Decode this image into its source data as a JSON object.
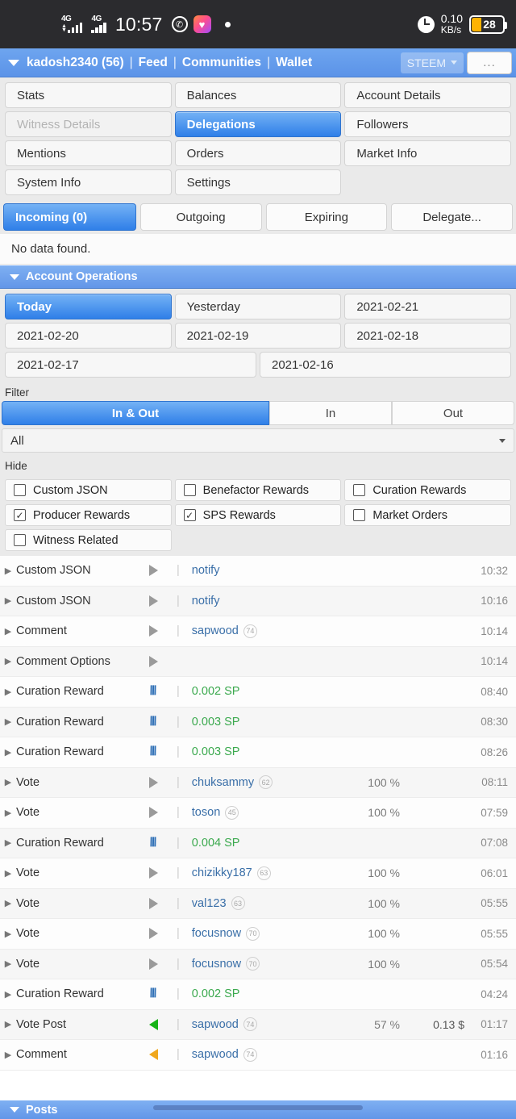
{
  "statusbar": {
    "network1": "4G",
    "network2": "4G",
    "time": "10:57",
    "whatsapp_icon": "whatsapp-icon",
    "gallery_icon": "heart-app-icon",
    "dot_icon": "dot-icon",
    "alarm_icon": "alarm-clock-icon",
    "netspeed_value": "0.10",
    "netspeed_unit": "KB/s",
    "battery_level": "28"
  },
  "appbar": {
    "account": "kadosh2340 (56)",
    "sep": "|",
    "nav": [
      "Feed",
      "Communities",
      "Wallet"
    ],
    "chain_chip": "STEEM",
    "more_label": "..."
  },
  "nav_tiles": [
    {
      "label": "Stats",
      "state": "normal"
    },
    {
      "label": "Balances",
      "state": "normal"
    },
    {
      "label": "Account Details",
      "state": "normal"
    },
    {
      "label": "Witness Details",
      "state": "disabled"
    },
    {
      "label": "Delegations",
      "state": "active"
    },
    {
      "label": "Followers",
      "state": "normal"
    },
    {
      "label": "Mentions",
      "state": "normal"
    },
    {
      "label": "Orders",
      "state": "normal"
    },
    {
      "label": "Market Info",
      "state": "normal"
    },
    {
      "label": "System Info",
      "state": "normal"
    },
    {
      "label": "Settings",
      "state": "normal"
    },
    {
      "label": "",
      "state": "blank"
    }
  ],
  "delegation_tabs": [
    {
      "label": "Incoming (0)",
      "active": true
    },
    {
      "label": "Outgoing",
      "active": false
    },
    {
      "label": "Expiring",
      "active": false
    },
    {
      "label": "Delegate...",
      "active": false
    }
  ],
  "delegation_empty": "No data found.",
  "account_operations": {
    "section_title": "Account Operations",
    "date_tiles": [
      {
        "label": "Today",
        "active": true,
        "width": "w3"
      },
      {
        "label": "Yesterday",
        "active": false,
        "width": "w3"
      },
      {
        "label": "2021-02-21",
        "active": false,
        "width": "w3"
      },
      {
        "label": "2021-02-20",
        "active": false,
        "width": "w3"
      },
      {
        "label": "2021-02-19",
        "active": false,
        "width": "w3"
      },
      {
        "label": "2021-02-18",
        "active": false,
        "width": "w3"
      },
      {
        "label": "2021-02-17",
        "active": false,
        "width": "w2"
      },
      {
        "label": "2021-02-16",
        "active": false,
        "width": "w2"
      }
    ],
    "filter_label": "Filter",
    "direction_buttons": [
      {
        "label": "In & Out",
        "active": true
      },
      {
        "label": "In",
        "active": false
      },
      {
        "label": "Out",
        "active": false
      }
    ],
    "type_select_value": "All",
    "hide_label": "Hide",
    "hide_checkboxes": [
      {
        "label": "Custom JSON",
        "checked": false
      },
      {
        "label": "Benefactor Rewards",
        "checked": false
      },
      {
        "label": "Curation Rewards",
        "checked": false
      },
      {
        "label": "Producer Rewards",
        "checked": true
      },
      {
        "label": "SPS Rewards",
        "checked": true
      },
      {
        "label": "Market Orders",
        "checked": false
      },
      {
        "label": "Witness Related",
        "checked": false
      }
    ]
  },
  "operations": [
    {
      "type": "Custom JSON",
      "icon": "arrow-right-gray",
      "user": "notify",
      "rep": "",
      "amount": "",
      "pct": "",
      "value": "",
      "time": "10:32"
    },
    {
      "type": "Custom JSON",
      "icon": "arrow-right-gray",
      "user": "notify",
      "rep": "",
      "amount": "",
      "pct": "",
      "value": "",
      "time": "10:16"
    },
    {
      "type": "Comment",
      "icon": "arrow-right-gray",
      "user": "sapwood",
      "rep": "74",
      "amount": "",
      "pct": "",
      "value": "",
      "time": "10:14"
    },
    {
      "type": "Comment Options",
      "icon": "arrow-right-gray",
      "user": "",
      "rep": "",
      "amount": "",
      "pct": "",
      "value": "",
      "time": "10:14"
    },
    {
      "type": "Curation Reward",
      "icon": "steem-logo",
      "user": "",
      "rep": "",
      "amount": "0.002 SP",
      "pct": "",
      "value": "",
      "time": "08:40"
    },
    {
      "type": "Curation Reward",
      "icon": "steem-logo",
      "user": "",
      "rep": "",
      "amount": "0.003 SP",
      "pct": "",
      "value": "",
      "time": "08:30"
    },
    {
      "type": "Curation Reward",
      "icon": "steem-logo",
      "user": "",
      "rep": "",
      "amount": "0.003 SP",
      "pct": "",
      "value": "",
      "time": "08:26"
    },
    {
      "type": "Vote",
      "icon": "arrow-right-gray",
      "user": "chuksammy",
      "rep": "62",
      "amount": "",
      "pct": "100 %",
      "value": "",
      "time": "08:11"
    },
    {
      "type": "Vote",
      "icon": "arrow-right-gray",
      "user": "toson",
      "rep": "45",
      "amount": "",
      "pct": "100 %",
      "value": "",
      "time": "07:59"
    },
    {
      "type": "Curation Reward",
      "icon": "steem-logo",
      "user": "",
      "rep": "",
      "amount": "0.004 SP",
      "pct": "",
      "value": "",
      "time": "07:08"
    },
    {
      "type": "Vote",
      "icon": "arrow-right-gray",
      "user": "chizikky187",
      "rep": "63",
      "amount": "",
      "pct": "100 %",
      "value": "",
      "time": "06:01"
    },
    {
      "type": "Vote",
      "icon": "arrow-right-gray",
      "user": "val123",
      "rep": "63",
      "amount": "",
      "pct": "100 %",
      "value": "",
      "time": "05:55"
    },
    {
      "type": "Vote",
      "icon": "arrow-right-gray",
      "user": "focusnow",
      "rep": "70",
      "amount": "",
      "pct": "100 %",
      "value": "",
      "time": "05:55"
    },
    {
      "type": "Vote",
      "icon": "arrow-right-gray",
      "user": "focusnow",
      "rep": "70",
      "amount": "",
      "pct": "100 %",
      "value": "",
      "time": "05:54"
    },
    {
      "type": "Curation Reward",
      "icon": "steem-logo",
      "user": "",
      "rep": "",
      "amount": "0.002 SP",
      "pct": "",
      "value": "",
      "time": "04:24"
    },
    {
      "type": "Vote Post",
      "icon": "arrow-left-green",
      "user": "sapwood",
      "rep": "74",
      "amount": "",
      "pct": "57 %",
      "value": "0.13 $",
      "time": "01:17"
    },
    {
      "type": "Comment",
      "icon": "arrow-left-orange",
      "user": "sapwood",
      "rep": "74",
      "amount": "",
      "pct": "",
      "value": "",
      "time": "01:16"
    }
  ],
  "bottom_section": {
    "title": "Posts"
  },
  "colors": {
    "accent_blue": "#2f7fe8",
    "header_blue": "#6296e8",
    "green_amount": "#3ba94e",
    "user_link": "#3a6fa8",
    "battery_orange": "#ffb302"
  }
}
